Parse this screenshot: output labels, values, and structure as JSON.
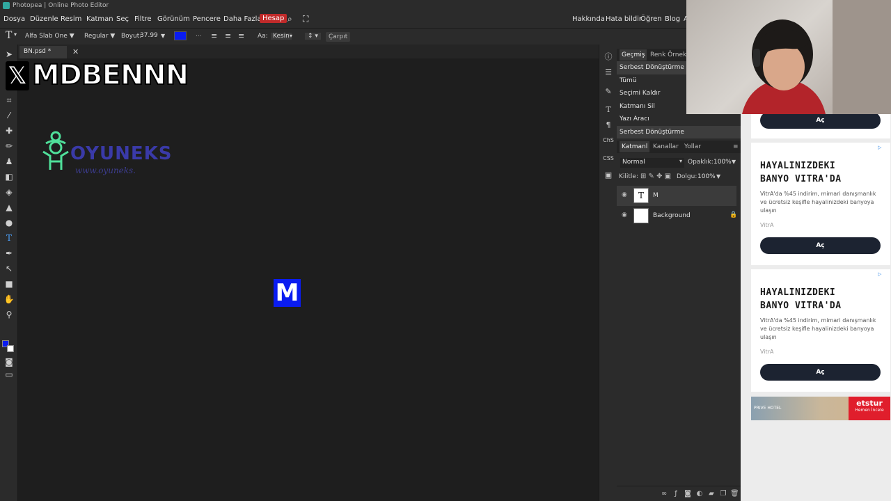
{
  "window": {
    "title": "Photopea | Online Photo Editor"
  },
  "menu": {
    "items": [
      "Dosya",
      "Düzenle",
      "Resim",
      "Katman",
      "Seç",
      "Filtre",
      "Görünüm",
      "Pencere",
      "Daha Fazla"
    ],
    "highlight": "Hesap",
    "right_items": [
      "Hakkında",
      "Hata bildir",
      "Öğren",
      "Blog",
      "A"
    ]
  },
  "options": {
    "font": "Alfa Slab One ▼",
    "style": "Regular ▼",
    "size_label": "Boyut:",
    "size_value": "37.99",
    "color": "#0a1cf0",
    "aa_label": "Aa:",
    "aa_value": "Kesin",
    "ellipsis": "...",
    "warp": "Çarpıt"
  },
  "document": {
    "tab_label": "BN.psd *"
  },
  "canvas": {
    "watermark_x": "𝕏",
    "watermark_text": "MDBENNN",
    "logo_text": "OYUNEKS",
    "logo_url": "www.oyuneks.",
    "text_layer": "M"
  },
  "history": {
    "tabs": [
      "Geçmiş",
      "Renk Örnekle"
    ],
    "items": [
      "Serbest Dönüştürme",
      "Tümü",
      "Seçimi Kaldır",
      "Katmanı Sil",
      "Yazı Aracı",
      "Serbest Dönüştürme"
    ]
  },
  "layers": {
    "tabs": [
      "Katmanl",
      "Kanallar",
      "Yollar"
    ],
    "blend_mode": "Normal",
    "opacity_label": "Opaklık:",
    "opacity_value": "100%",
    "lock_label": "Kilitle:",
    "fill_label": "Dolgu:",
    "fill_value": "100%",
    "items": [
      {
        "name": "M",
        "thumb": "T"
      },
      {
        "name": "Background",
        "thumb": ""
      }
    ]
  },
  "ads": {
    "top_button": "Aç",
    "cards": [
      {
        "title": "HAYALINIZDEKI BANYO VITRA'DA",
        "desc": "VitrA'da %45 indirim, mimari danışmanlık ve ücretsiz keşifle hayalinizdeki banyoya ulaşın",
        "brand": "VitrA",
        "button": "Aç"
      },
      {
        "title": "HAYALINIZDEKI BANYO VITRA'DA",
        "desc": "VitrA'da %45 indirim, mimari danışmanlık ve ücretsiz keşifle hayalinizdeki banyoya ulaşın",
        "brand": "VitrA",
        "button": "Aç"
      }
    ],
    "banner_brand": "etstur",
    "banner_cta": "Hemen İncele",
    "banner_left": "PRIVE HOTEL"
  },
  "colors": {
    "accent_red": "#c02a2a",
    "fg_color": "#0a1cf0",
    "bg_color": "#ffffff"
  }
}
